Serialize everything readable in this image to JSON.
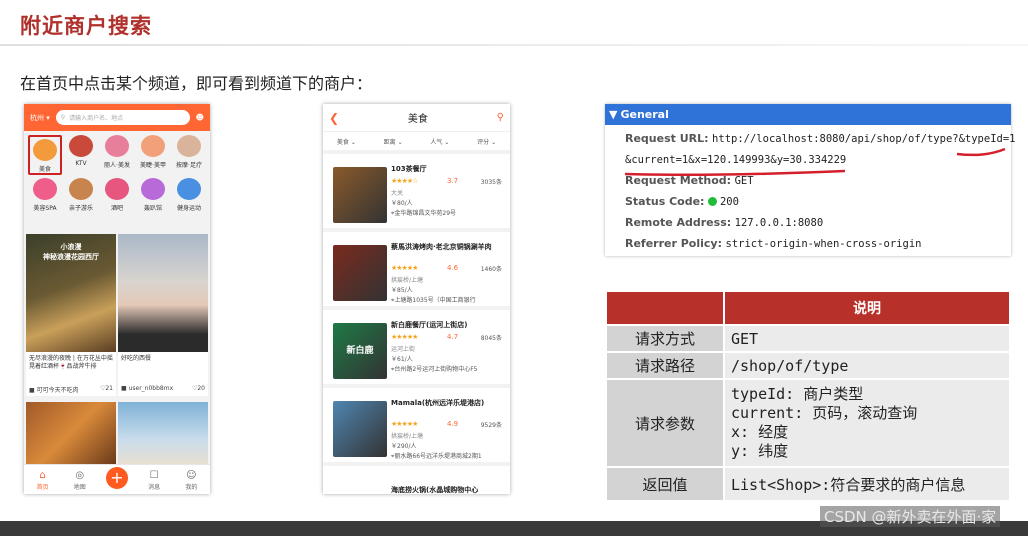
{
  "slide": {
    "title": "附近商户搜索",
    "intro": "在首页中点击某个频道，即可看到频道下的商户："
  },
  "phone_home": {
    "city": "杭州",
    "search_placeholder": "请输入商户名、地点",
    "channels": [
      {
        "label": "美食",
        "color": "#f39b3c",
        "selected": true
      },
      {
        "label": "KTV",
        "color": "#c94a3a",
        "selected": false
      },
      {
        "label": "丽人·美发",
        "color": "#e87f9a",
        "selected": false
      },
      {
        "label": "美睫·美甲",
        "color": "#f2a07a",
        "selected": false
      },
      {
        "label": "按摩·足疗",
        "color": "#d9b39a",
        "selected": false
      },
      {
        "label": "美容SPA",
        "color": "#ef5d8a",
        "selected": false
      },
      {
        "label": "亲子游乐",
        "color": "#c8844e",
        "selected": false
      },
      {
        "label": "酒吧",
        "color": "#e6567f",
        "selected": false
      },
      {
        "label": "轰趴馆",
        "color": "#b86ad8",
        "selected": false
      },
      {
        "label": "健身运动",
        "color": "#4a90e2",
        "selected": false
      }
    ],
    "feed": [
      {
        "title": "无尽浪漫的夜晚 | 在万花丛中摇晃着红酒杯🍷品战斧牛排",
        "author": "可可今天不吃肉",
        "likes": "21",
        "banner": "小浪漫\n神秘浪漫花园西厅"
      },
      {
        "title": "好吃的西餐",
        "author": "user_n0bb8mx",
        "likes": "20",
        "banner": ""
      }
    ],
    "tabs": [
      {
        "label": "首页",
        "icon": "home-icon",
        "active": true
      },
      {
        "label": "地图",
        "icon": "map-icon",
        "active": false
      },
      {
        "label": "+",
        "icon": "plus-icon",
        "active": false
      },
      {
        "label": "消息",
        "icon": "message-icon",
        "active": false
      },
      {
        "label": "我的",
        "icon": "profile-icon",
        "active": false
      }
    ]
  },
  "phone_list": {
    "title": "美食",
    "filters": [
      "美食",
      "距离",
      "人气",
      "评分"
    ],
    "shops": [
      {
        "name": "103茶餐厅",
        "rating": "3.7",
        "stars": 3.7,
        "count": "3035条",
        "area": "大关",
        "price": "￥80/人",
        "address": "金华路锦昌文华苑29号",
        "color": "#8a5a2b"
      },
      {
        "name": "蔡馬洪涛烤肉·老北京铜锅涮羊肉",
        "rating": "4.6",
        "stars": 4.6,
        "count": "1460条",
        "area": "拱宸桥/上塘",
        "price": "￥85/人",
        "address": "上塘路1035号（中国工商银行",
        "color": "#7a2a1e"
      },
      {
        "name": "新白鹿餐厅(运河上街店)",
        "rating": "4.7",
        "stars": 4.7,
        "count": "8045条",
        "area": "运河上街",
        "price": "￥61/人",
        "address": "台州路2号运河上街购物中心F5",
        "color": "#1e7a46",
        "logo": "新白鹿"
      },
      {
        "name": "Mamala(杭州远洋乐堤港店)",
        "rating": "4.9",
        "stars": 4.9,
        "count": "9529条",
        "area": "拱宸桥/上塘",
        "price": "￥290/人",
        "address": "丽水路66号远洋乐堤港商城2期1",
        "color": "#4f86b0"
      }
    ],
    "last_item": "海底捞火锅(水晶城购物中心"
  },
  "general": {
    "header": "General",
    "rows": [
      {
        "label": "Request URL:",
        "value": "http://localhost:8080/api/shop/of/type?&typeId=1"
      },
      {
        "label": "",
        "value": "&current=1&x=120.149993&y=30.334229"
      },
      {
        "label": "Request Method:",
        "value": "GET"
      },
      {
        "label": "Status Code:",
        "value": "200"
      },
      {
        "label": "Remote Address:",
        "value": "127.0.0.1:8080"
      },
      {
        "label": "Referrer Policy:",
        "value": "strict-origin-when-cross-origin"
      }
    ]
  },
  "spec_table": {
    "header": "说明",
    "rows": [
      {
        "label": "请求方式",
        "value": "GET"
      },
      {
        "label": "请求路径",
        "value": "/shop/of/type"
      },
      {
        "label": "请求参数",
        "lines": [
          "typeId: 商户类型",
          "current: 页码，滚动查询",
          "x: 经度",
          "y: 纬度"
        ]
      },
      {
        "label": "返回值",
        "value": "List<Shop>:符合要求的商户信息"
      }
    ]
  },
  "watermark": "CSDN @新外卖在外面·家",
  "colors": {
    "accent": "#ff6633",
    "title_red": "#b0302c",
    "table_red": "#b8302a",
    "devtools_blue": "#2f73d9",
    "status_green": "#1fbb3b"
  }
}
